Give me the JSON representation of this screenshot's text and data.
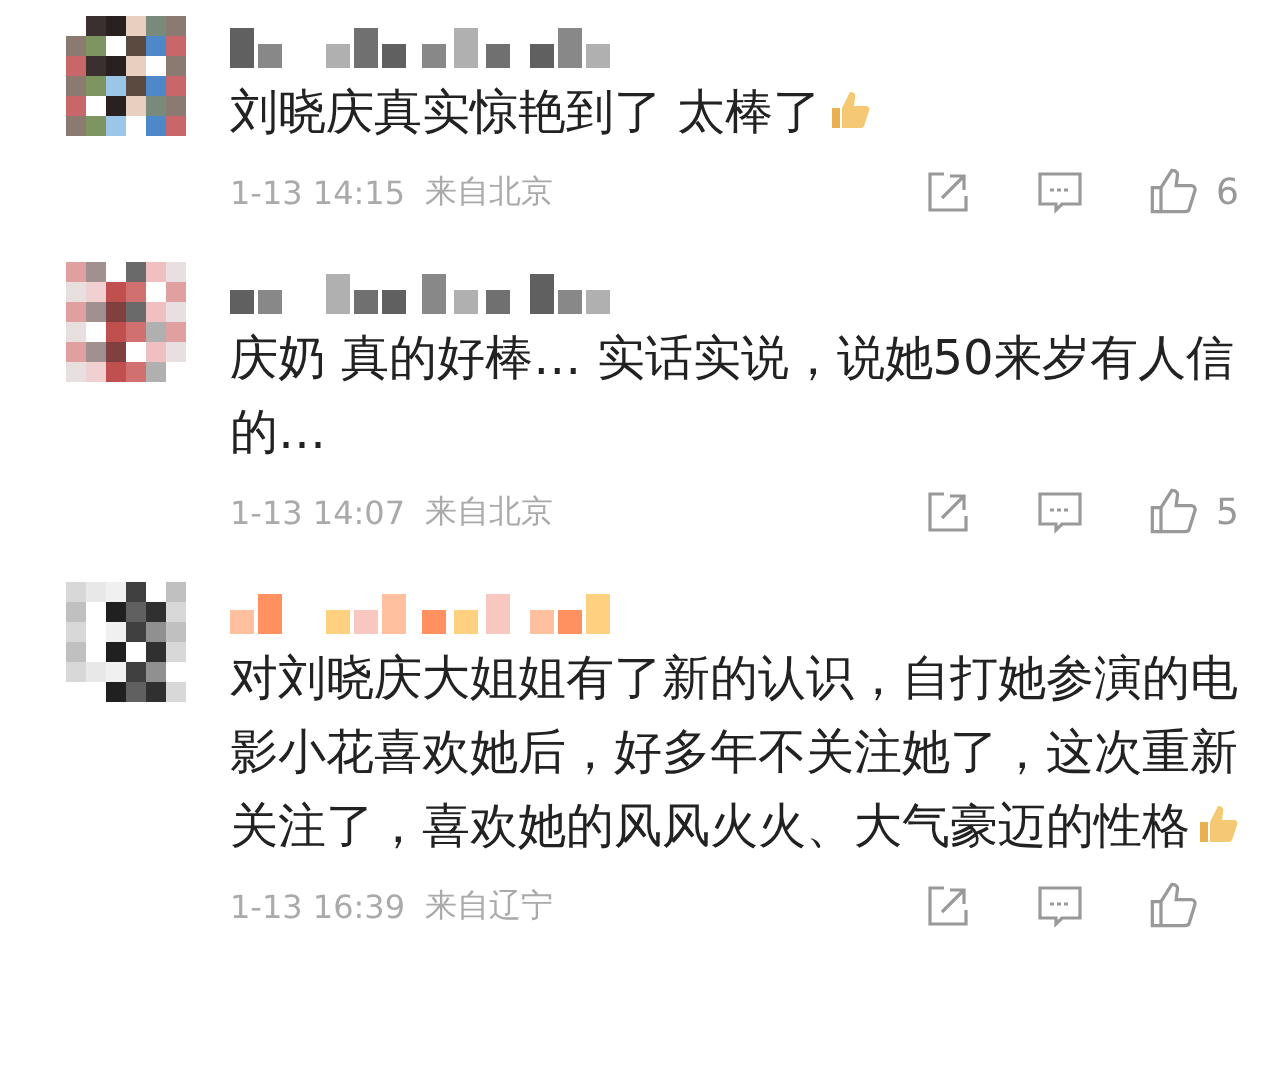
{
  "comments": [
    {
      "text": "刘晓庆真实惊艳到了 太棒了",
      "emoji": true,
      "time": "1-13 14:15",
      "location": "来自北京",
      "likes": "6"
    },
    {
      "text": "庆奶 真的好棒… 实话实说，说她50来岁有人信的…",
      "emoji": false,
      "time": "1-13 14:07",
      "location": "来自北京",
      "likes": "5"
    },
    {
      "text": "对刘晓庆大姐姐有了新的认识，自打她参演的电影小花喜欢她后，好多年不关注她了，这次重新关注了，喜欢她的风风火火、大气豪迈的性格",
      "emoji": true,
      "time": "1-13 16:39",
      "location": "来自辽宁"
    }
  ]
}
